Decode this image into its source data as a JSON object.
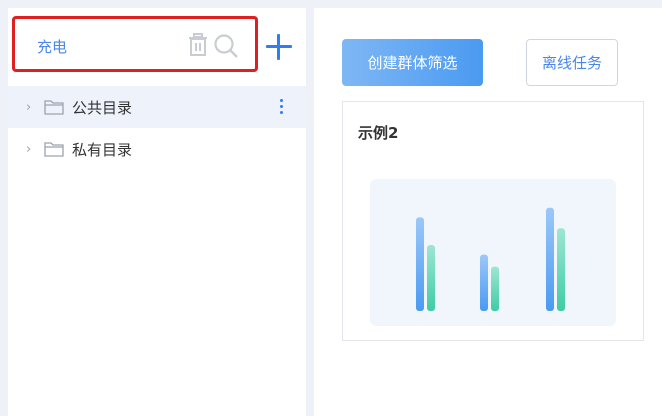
{
  "left_panel": {
    "search": {
      "value": "充电",
      "placeholder": ""
    },
    "tree": [
      {
        "label": "公共目录",
        "active": true
      },
      {
        "label": "私有目录",
        "active": false
      }
    ]
  },
  "right_panel": {
    "buttons": {
      "create_label": "创建群体筛选",
      "offline_label": "离线任务"
    },
    "card": {
      "title": "示例2",
      "bars": [
        {
          "a": 0.78,
          "b": 0.55
        },
        {
          "a": 0.47,
          "b": 0.37
        },
        {
          "a": 0.86,
          "b": 0.69
        }
      ]
    }
  },
  "colors": {
    "accent": "#2f7cf6",
    "highlight_border": "#e02020",
    "bar_blue": "#4a9af2",
    "bar_green": "#3fcca6"
  }
}
